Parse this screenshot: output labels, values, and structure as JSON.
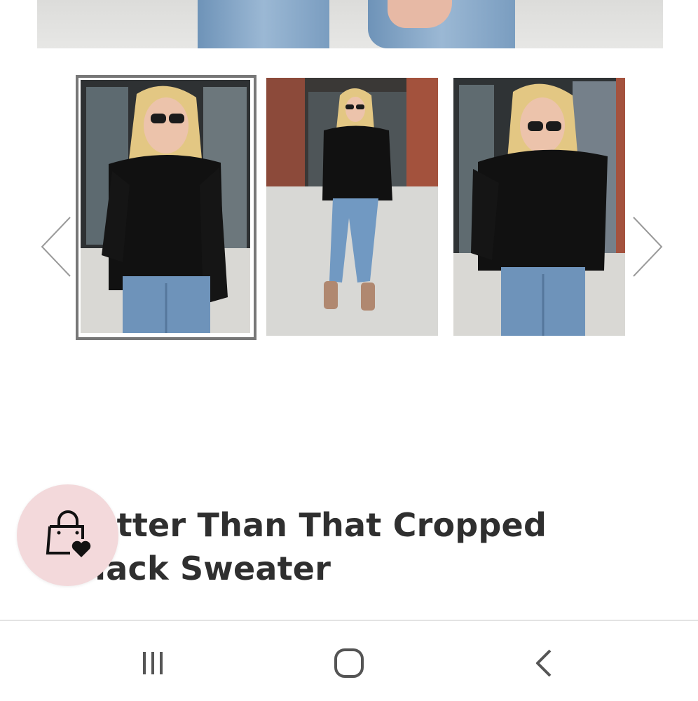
{
  "product": {
    "title": "Better Than That Cropped Black Sweater"
  },
  "gallery": {
    "selected_index": 0,
    "thumbnails": [
      {
        "name": "thumbnail-1"
      },
      {
        "name": "thumbnail-2"
      },
      {
        "name": "thumbnail-3"
      }
    ]
  },
  "icons": {
    "prev": "chevron-left-icon",
    "next": "chevron-right-icon",
    "wishlist": "shopping-bag-heart-icon",
    "recent_apps": "recent-apps-icon",
    "home": "home-icon",
    "back": "back-icon"
  },
  "colors": {
    "title_text": "#2f2f2f",
    "wishlist_bubble": "#f3d9db",
    "selected_border": "#777777"
  }
}
